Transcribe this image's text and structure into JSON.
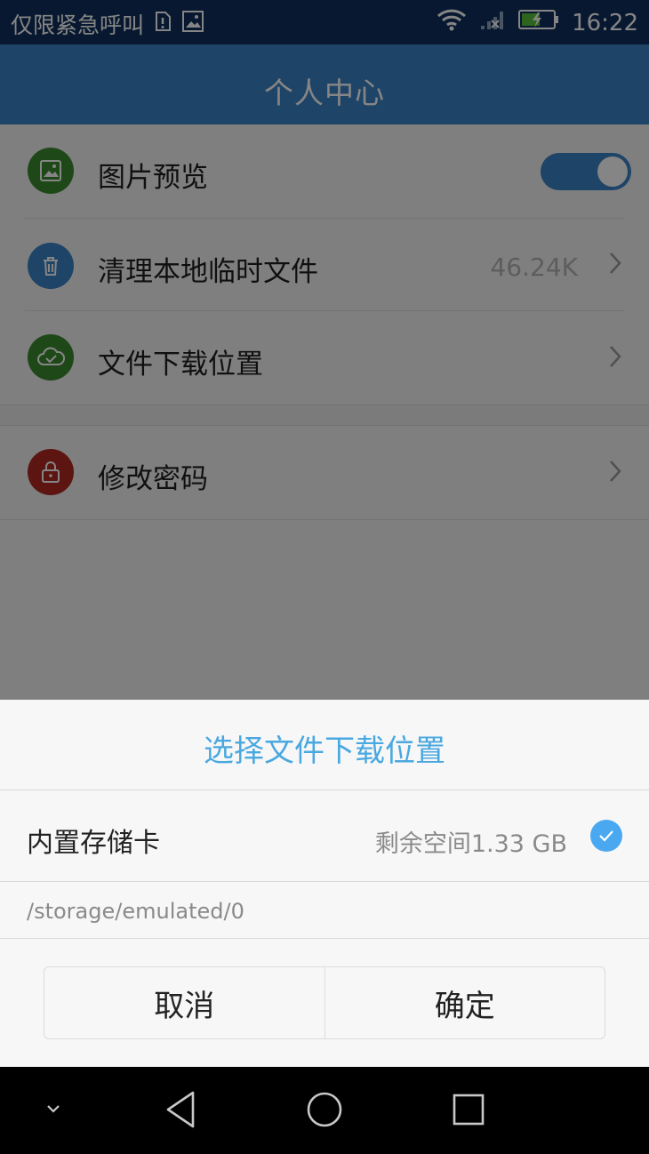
{
  "status_bar": {
    "carrier_text": "仅限紧急呼叫",
    "time": "16:22",
    "icons": [
      "sim-alert-icon",
      "image-icon",
      "wifi-icon",
      "signal-icon",
      "battery-charging-icon"
    ]
  },
  "app_bar": {
    "title": "个人中心"
  },
  "settings": {
    "items": [
      {
        "label": "图片预览",
        "icon": "image-icon",
        "icon_color": "#3b8a2f",
        "toggle_on": true
      },
      {
        "label": "清理本地临时文件",
        "icon": "trash-icon",
        "icon_color": "#3a82c6",
        "value": "46.24K"
      },
      {
        "label": "文件下载位置",
        "icon": "cloud-check-icon",
        "icon_color": "#3b8a2f"
      },
      {
        "label": "修改密码",
        "icon": "lock-icon",
        "icon_color": "#b02a22"
      }
    ]
  },
  "dialog": {
    "title": "选择文件下载位置",
    "storage": {
      "name": "内置存储卡",
      "free_space": "剩余空间1.33 GB",
      "path": "/storage/emulated/0",
      "selected": true
    },
    "cancel_label": "取消",
    "confirm_label": "确定"
  },
  "nav_bar": {
    "icons": [
      "chevron-down-icon",
      "back-icon",
      "home-icon",
      "recents-icon"
    ]
  },
  "colors": {
    "status_bar": "#0f2f5c",
    "app_bar": "#3a82c6",
    "dialog_title": "#4aa8e0",
    "check": "#4aa8f0"
  }
}
